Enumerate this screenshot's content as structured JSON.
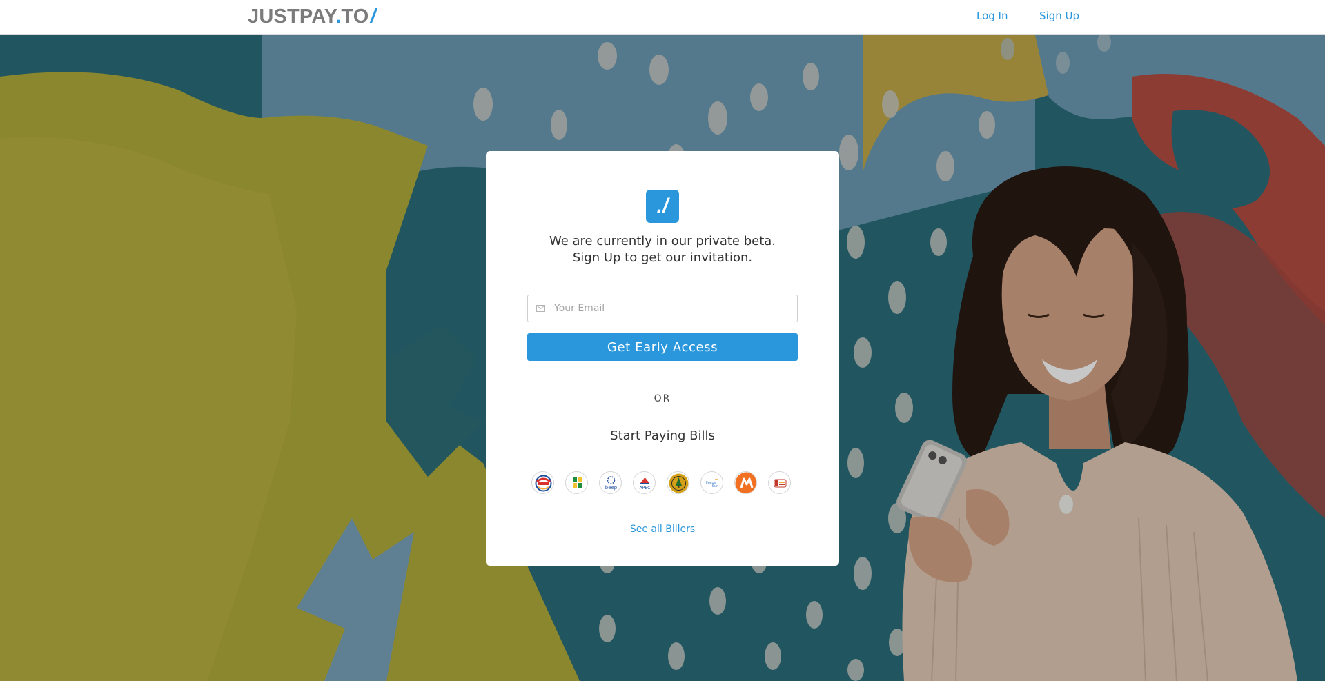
{
  "header": {
    "logo": {
      "brand": "JUSTPAY",
      "dot": ".",
      "tld": "TO",
      "slash": "/"
    },
    "nav": {
      "login": "Log In",
      "signup": "Sign Up"
    }
  },
  "card": {
    "badge": "./",
    "beta_line_1": "We are currently in our private beta.",
    "beta_line_2": "Sign Up to get our invitation.",
    "email": {
      "placeholder": "Your Email",
      "value": ""
    },
    "cta": "Get Early Access",
    "or": "OR",
    "bills_title": "Start Paying Bills",
    "billers": [
      {
        "icon": "biller-1-icon",
        "color": "#d9322e"
      },
      {
        "icon": "biller-2-icon",
        "color": "#1e8f3a"
      },
      {
        "icon": "biller-beep-icon",
        "color": "#2b57a6"
      },
      {
        "icon": "biller-apec-icon",
        "color": "#1d4fa0"
      },
      {
        "icon": "biller-5-icon",
        "color": "#d4a017"
      },
      {
        "icon": "biller-6-icon",
        "color": "#3b7bc9"
      },
      {
        "icon": "biller-7-icon",
        "color": "#f27022"
      },
      {
        "icon": "biller-8-icon",
        "color": "#c0392b"
      }
    ],
    "see_all": "See all Billers"
  },
  "colors": {
    "accent": "#2a97dc",
    "logo_gray": "#7b7b7b",
    "mural_teal": "#2b6f7c",
    "mural_yellow": "#b3ad3c",
    "mural_blue": "#6e9cb4",
    "mural_red": "#b54d43"
  }
}
